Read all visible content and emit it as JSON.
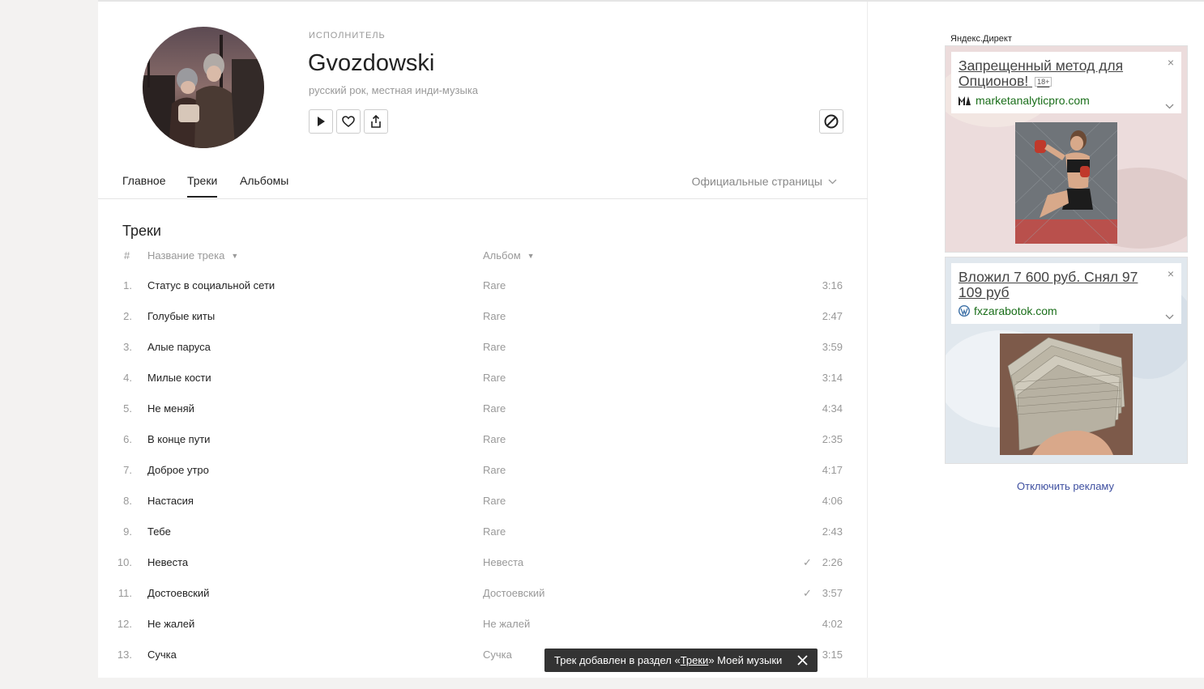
{
  "artist": {
    "type_label": "ИСПОЛНИТЕЛЬ",
    "name": "Gvozdowski",
    "genres": "русский рок, местная инди-музыка"
  },
  "actions": {
    "play_icon": "play-icon",
    "like_icon": "heart-icon",
    "share_icon": "share-icon",
    "block_icon": "block-icon"
  },
  "tabs": [
    {
      "label": "Главное",
      "active": false
    },
    {
      "label": "Треки",
      "active": true
    },
    {
      "label": "Альбомы",
      "active": false
    }
  ],
  "official_pages": "Официальные страницы",
  "tracks_section": {
    "title": "Треки",
    "columns": {
      "num": "#",
      "title": "Название трека",
      "album": "Альбом"
    },
    "rows": [
      {
        "num": "1.",
        "title": "Статус в социальной сети",
        "album": "Rare",
        "liked": "",
        "duration": "3:16"
      },
      {
        "num": "2.",
        "title": "Голубые киты",
        "album": "Rare",
        "liked": "",
        "duration": "2:47"
      },
      {
        "num": "3.",
        "title": "Алые паруса",
        "album": "Rare",
        "liked": "",
        "duration": "3:59"
      },
      {
        "num": "4.",
        "title": "Милые кости",
        "album": "Rare",
        "liked": "",
        "duration": "3:14"
      },
      {
        "num": "5.",
        "title": "Не меняй",
        "album": "Rare",
        "liked": "",
        "duration": "4:34"
      },
      {
        "num": "6.",
        "title": "В конце пути",
        "album": "Rare",
        "liked": "",
        "duration": "2:35"
      },
      {
        "num": "7.",
        "title": "Доброе утро",
        "album": "Rare",
        "liked": "",
        "duration": "4:17"
      },
      {
        "num": "8.",
        "title": "Настасия",
        "album": "Rare",
        "liked": "",
        "duration": "4:06"
      },
      {
        "num": "9.",
        "title": "Тебе",
        "album": "Rare",
        "liked": "",
        "duration": "2:43"
      },
      {
        "num": "10.",
        "title": "Невеста",
        "album": "Невеста",
        "liked": "✓",
        "duration": "2:26"
      },
      {
        "num": "11.",
        "title": "Достоевский",
        "album": "Достоевский",
        "liked": "✓",
        "duration": "3:57"
      },
      {
        "num": "12.",
        "title": "Не жалей",
        "album": "Не жалей",
        "liked": "",
        "duration": "4:02"
      },
      {
        "num": "13.",
        "title": "Сучка",
        "album": "Сучка",
        "liked": "",
        "duration": "3:15"
      }
    ]
  },
  "toast": {
    "prefix": "Трек добавлен в раздел «",
    "link": "Треки",
    "suffix": "» Моей музыки",
    "close_icon": "close-icon"
  },
  "ads": {
    "label": "Яндекс.Директ",
    "items": [
      {
        "title": "Запрещенный метод для Опционов!",
        "age": "18+",
        "domain": "marketanalyticpro.com",
        "close": "×"
      },
      {
        "title": "Вложил 7 600 руб. Снял 97 109 руб",
        "age": "",
        "domain": "fxzarabotok.com",
        "close": "×"
      }
    ],
    "disable": "Отключить рекламу"
  },
  "colors": {
    "accent_link": "#3e4fa0",
    "ad_domain": "#1a6e1a",
    "toast_bg": "#333333"
  }
}
